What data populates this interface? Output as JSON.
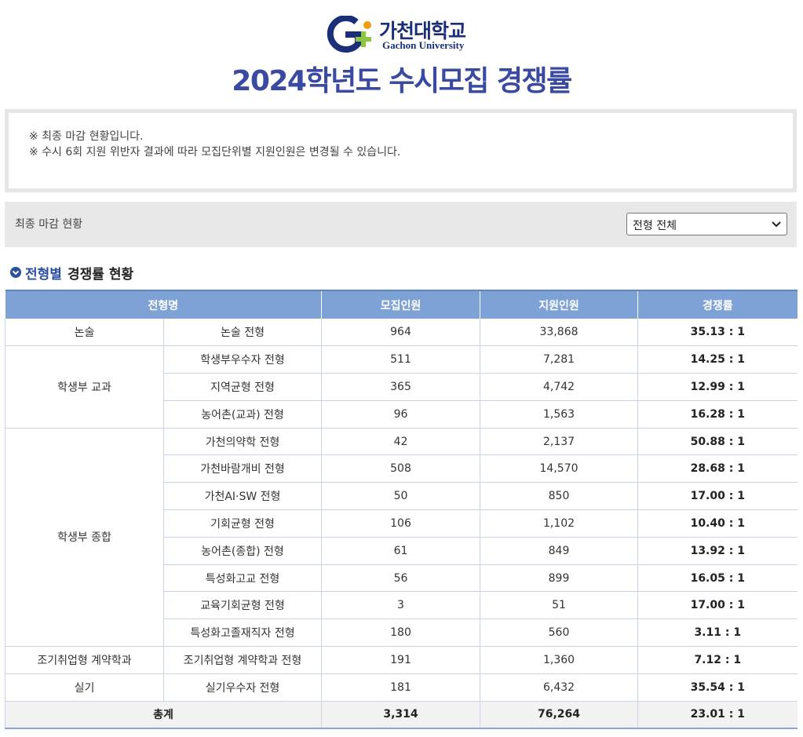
{
  "header": {
    "logo_korean": "가천대학교",
    "logo_english": "Gachon University",
    "title": "2024학년도 수시모집 경쟁률",
    "colors": {
      "brand_navy": "#1a2f78",
      "logo_blue": "#3a7bd5",
      "logo_green": "#8dc63f",
      "logo_orange": "#f39c12",
      "title": "#3a4aa3"
    }
  },
  "notice": {
    "lines": [
      "※ 최종 마감 현황입니다.",
      "※ 수시 6회 지원 위반자 결과에 따라 모집단위별 지원인원은 변경될 수 있습니다."
    ]
  },
  "filter": {
    "label": "최종 마감 현황",
    "select_value": "전형 전체",
    "icon": "chevron-down-icon"
  },
  "section": {
    "icon": "circle-chevron-icon",
    "highlight": "전형별",
    "title": "경쟁률 현황"
  },
  "table": {
    "headers": [
      "전형명",
      "모집인원",
      "지원인원",
      "경쟁률"
    ],
    "header_color": "#7fa2d6",
    "groups": [
      {
        "category": "논술",
        "rows": [
          {
            "type": "논술 전형",
            "quota": "964",
            "applicants": "33,868",
            "rate": "35.13 : 1"
          }
        ]
      },
      {
        "category": "학생부 교과",
        "rows": [
          {
            "type": "학생부우수자 전형",
            "quota": "511",
            "applicants": "7,281",
            "rate": "14.25 : 1"
          },
          {
            "type": "지역균형 전형",
            "quota": "365",
            "applicants": "4,742",
            "rate": "12.99 : 1"
          },
          {
            "type": "농어촌(교과) 전형",
            "quota": "96",
            "applicants": "1,563",
            "rate": "16.28 : 1"
          }
        ]
      },
      {
        "category": "학생부 종합",
        "rows": [
          {
            "type": "가천의약학 전형",
            "quota": "42",
            "applicants": "2,137",
            "rate": "50.88 : 1"
          },
          {
            "type": "가천바람개비 전형",
            "quota": "508",
            "applicants": "14,570",
            "rate": "28.68 : 1"
          },
          {
            "type": "가천AI·SW 전형",
            "quota": "50",
            "applicants": "850",
            "rate": "17.00 : 1"
          },
          {
            "type": "기회균형 전형",
            "quota": "106",
            "applicants": "1,102",
            "rate": "10.40 : 1"
          },
          {
            "type": "농어촌(종합) 전형",
            "quota": "61",
            "applicants": "849",
            "rate": "13.92 : 1"
          },
          {
            "type": "특성화고교 전형",
            "quota": "56",
            "applicants": "899",
            "rate": "16.05 : 1"
          },
          {
            "type": "교육기회균형 전형",
            "quota": "3",
            "applicants": "51",
            "rate": "17.00 : 1"
          },
          {
            "type": "특성화고졸재직자 전형",
            "quota": "180",
            "applicants": "560",
            "rate": "3.11 : 1"
          }
        ]
      },
      {
        "category": "조기취업형 계약학과",
        "rows": [
          {
            "type": "조기취업형 계약학과 전형",
            "quota": "191",
            "applicants": "1,360",
            "rate": "7.12 : 1"
          }
        ]
      },
      {
        "category": "실기",
        "rows": [
          {
            "type": "실기우수자 전형",
            "quota": "181",
            "applicants": "6,432",
            "rate": "35.54 : 1"
          }
        ]
      }
    ],
    "total": {
      "label": "총계",
      "quota": "3,314",
      "applicants": "76,264",
      "rate": "23.01 : 1"
    }
  }
}
